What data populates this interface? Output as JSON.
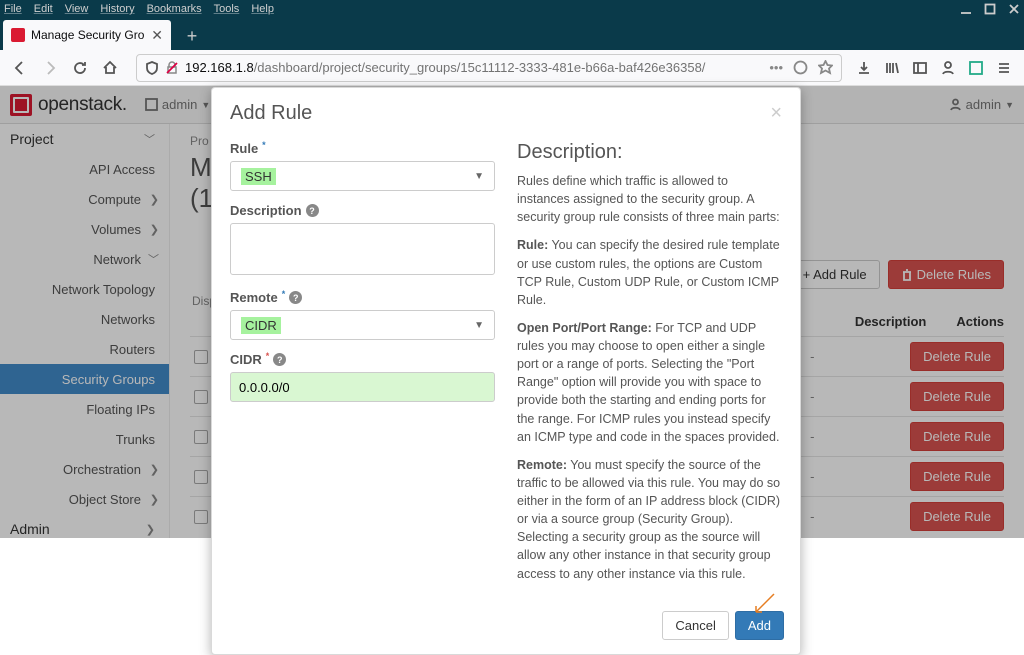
{
  "browser_menu": [
    "File",
    "Edit",
    "View",
    "History",
    "Bookmarks",
    "Tools",
    "Help"
  ],
  "tab": {
    "title": "Manage Security Group Rules"
  },
  "url": {
    "host": "192.168.1.8",
    "path": "/dashboard/project/security_groups/15c11112-3333-481e-b66a-baf426e36358/"
  },
  "openstack": {
    "brand": "openstack.",
    "domain_label": "admin",
    "user_label": "admin"
  },
  "sidebar": {
    "top": "Project",
    "api": "API Access",
    "compute": "Compute",
    "volumes": "Volumes",
    "network": "Network",
    "net_items": [
      "Network Topology",
      "Networks",
      "Routers",
      "Security Groups",
      "Floating IPs",
      "Trunks"
    ],
    "orchestration": "Orchestration",
    "object_store": "Object Store",
    "admin": "Admin"
  },
  "page": {
    "crumb": "Pro",
    "title_l1": "Ma",
    "title_l2": "(1",
    "disp": "Disp",
    "add_rule": "+ Add Rule",
    "delete_rules": "Delete Rules",
    "th_desc": "Description",
    "th_act": "Actions",
    "delete_rule": "Delete Rule",
    "dash": "-"
  },
  "modal": {
    "title": "Add Rule",
    "rule_label": "Rule",
    "rule_value": "SSH",
    "desc_label": "Description",
    "remote_label": "Remote",
    "remote_value": "CIDR",
    "cidr_label": "CIDR",
    "cidr_value": "0.0.0.0/0",
    "cancel": "Cancel",
    "add": "Add",
    "desc_heading": "Description:",
    "para1": "Rules define which traffic is allowed to instances assigned to the security group. A security group rule consists of three main parts:",
    "para2_b": "Rule:",
    "para2": " You can specify the desired rule template or use custom rules, the options are Custom TCP Rule, Custom UDP Rule, or Custom ICMP Rule.",
    "para3_b": "Open Port/Port Range:",
    "para3": " For TCP and UDP rules you may choose to open either a single port or a range of ports. Selecting the \"Port Range\" option will provide you with space to provide both the starting and ending ports for the range. For ICMP rules you instead specify an ICMP type and code in the spaces provided.",
    "para4_b": "Remote:",
    "para4": " You must specify the source of the traffic to be allowed via this rule. You may do so either in the form of an IP address block (CIDR) or via a source group (Security Group). Selecting a security group as the source will allow any other instance in that security group access to any other instance via this rule."
  }
}
